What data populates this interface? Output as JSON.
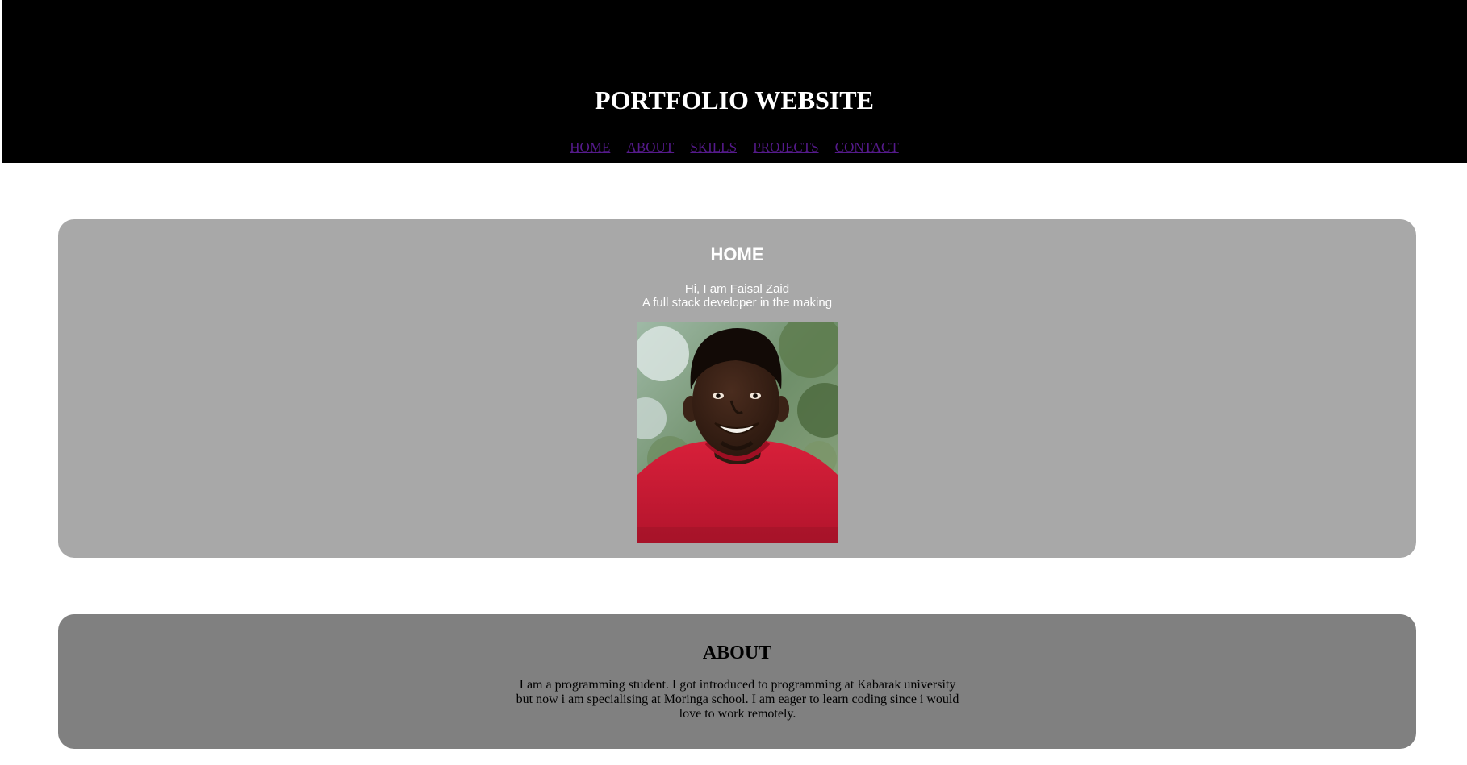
{
  "header": {
    "title": "PORTFOLIO WEBSITE",
    "nav": [
      "HOME",
      "ABOUT",
      "SKILLS",
      "PROJECTS",
      "CONTACT"
    ]
  },
  "home": {
    "heading": "HOME",
    "greeting": "Hi, I am Faisal Zaid",
    "tagline": "A full stack developer in the making",
    "photo_icon": "profile-photo"
  },
  "about": {
    "heading": "ABOUT",
    "body": "I am a programming student. I got introduced to programming at Kabarak university but now i am specialising at Moringa school. I am eager to learn coding since i would love to work remotely."
  },
  "colors": {
    "header_bg": "#000000",
    "home_panel_bg": "#a8a8a8",
    "about_panel_bg": "#808080",
    "link_visited": "#551a8b"
  }
}
